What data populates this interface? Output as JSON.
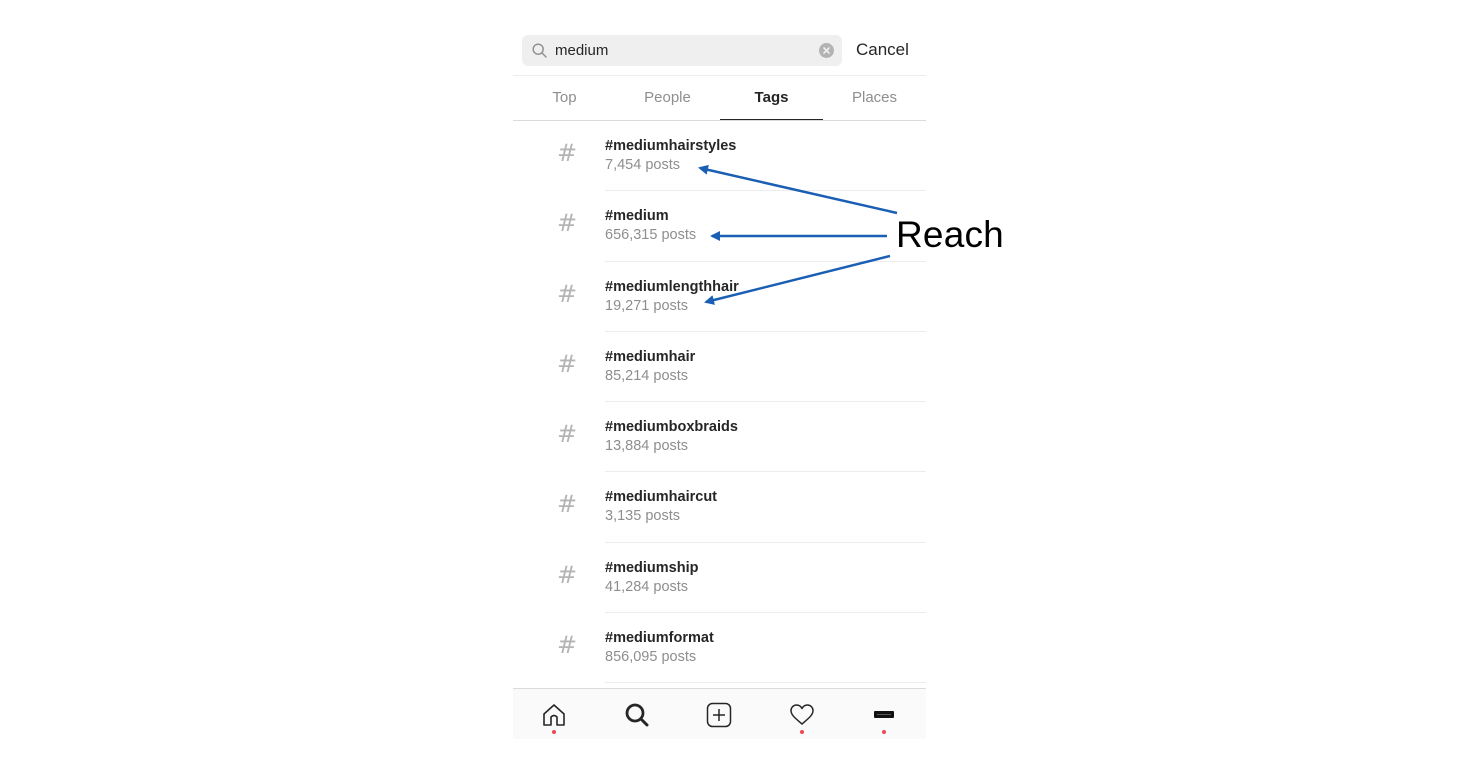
{
  "search": {
    "value": "medium",
    "placeholder": "Search",
    "cancel_label": "Cancel"
  },
  "tabs": [
    {
      "label": "Top"
    },
    {
      "label": "People"
    },
    {
      "label": "Tags",
      "active": true
    },
    {
      "label": "Places"
    }
  ],
  "results": [
    {
      "tag": "#mediumhairstyles",
      "posts": "7,454 posts"
    },
    {
      "tag": "#medium",
      "posts": "656,315 posts"
    },
    {
      "tag": "#mediumlengthhair",
      "posts": "19,271 posts"
    },
    {
      "tag": "#mediumhair",
      "posts": "85,214 posts"
    },
    {
      "tag": "#mediumboxbraids",
      "posts": "13,884 posts"
    },
    {
      "tag": "#mediumhaircut",
      "posts": "3,135 posts"
    },
    {
      "tag": "#mediumship",
      "posts": "41,284 posts"
    },
    {
      "tag": "#mediumformat",
      "posts": "856,095 posts"
    }
  ],
  "hash_symbol": "#",
  "tabbar": {
    "items": [
      {
        "icon": "home-icon",
        "notification_dot": true
      },
      {
        "icon": "search-icon",
        "active": true
      },
      {
        "icon": "plus-square-icon"
      },
      {
        "icon": "heart-icon",
        "notification_dot": true
      },
      {
        "icon": "profile-icon",
        "notification_dot": true
      }
    ]
  },
  "annotation": {
    "label": "Reach",
    "arrow_color": "#1a5fb4"
  },
  "colors": {
    "notification": "#ed4956",
    "secondary_text": "#8e8e8e",
    "primary_text": "#262626"
  }
}
